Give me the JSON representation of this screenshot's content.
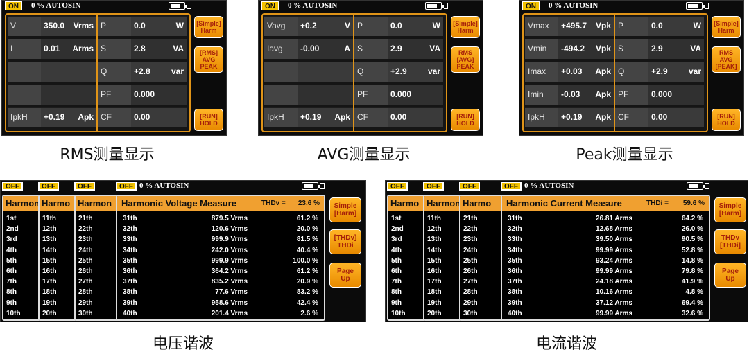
{
  "meter": {
    "status": "0 % AUTOSIN",
    "on": "ON",
    "off": "OFF"
  },
  "rms": {
    "rows_left": [
      {
        "label": "V",
        "value": "350.0",
        "unit": "Vrms"
      },
      {
        "label": "I",
        "value": "0.01",
        "unit": "Arms"
      },
      {
        "label": "",
        "value": "",
        "unit": ""
      },
      {
        "label": "",
        "value": "",
        "unit": ""
      },
      {
        "label": "IpkH",
        "value": "+0.19",
        "unit": "Apk"
      }
    ],
    "rows_right": [
      {
        "label": "P",
        "value": "0.0",
        "unit": "W"
      },
      {
        "label": "S",
        "value": "2.8",
        "unit": "VA"
      },
      {
        "label": "Q",
        "value": "+2.8",
        "unit": "var"
      },
      {
        "label": "PF",
        "value": "0.000",
        "unit": ""
      },
      {
        "label": "CF",
        "value": "0.00",
        "unit": ""
      }
    ],
    "btn1": "[Simple]\nHarm",
    "btn2": "[RMS]\nAVG\nPEAK",
    "btn3": "[RUN]\nHOLD",
    "caption": "RMS测量显示"
  },
  "avg": {
    "rows_left": [
      {
        "label": "Vavg",
        "value": "+0.2",
        "unit": "V"
      },
      {
        "label": "Iavg",
        "value": "-0.00",
        "unit": "A"
      },
      {
        "label": "",
        "value": "",
        "unit": ""
      },
      {
        "label": "",
        "value": "",
        "unit": ""
      },
      {
        "label": "IpkH",
        "value": "+0.19",
        "unit": "Apk"
      }
    ],
    "rows_right": [
      {
        "label": "P",
        "value": "0.0",
        "unit": "W"
      },
      {
        "label": "S",
        "value": "2.9",
        "unit": "VA"
      },
      {
        "label": "Q",
        "value": "+2.9",
        "unit": "var"
      },
      {
        "label": "PF",
        "value": "0.000",
        "unit": ""
      },
      {
        "label": "CF",
        "value": "0.00",
        "unit": ""
      }
    ],
    "btn1": "[Simple]\nHarm",
    "btn2": "RMS\n[AVG]\nPEAK",
    "btn3": "[RUN]\nHOLD",
    "caption": "AVG测量显示"
  },
  "peak": {
    "rows_left": [
      {
        "label": "Vmax",
        "value": "+495.7",
        "unit": "Vpk"
      },
      {
        "label": "Vmin",
        "value": "-494.2",
        "unit": "Vpk"
      },
      {
        "label": "Imax",
        "value": "+0.03",
        "unit": "Apk"
      },
      {
        "label": "Imin",
        "value": "-0.03",
        "unit": "Apk"
      },
      {
        "label": "IpkH",
        "value": "+0.19",
        "unit": "Apk"
      }
    ],
    "rows_right": [
      {
        "label": "P",
        "value": "0.0",
        "unit": "W"
      },
      {
        "label": "S",
        "value": "2.9",
        "unit": "VA"
      },
      {
        "label": "Q",
        "value": "+2.9",
        "unit": "var"
      },
      {
        "label": "PF",
        "value": "0.000",
        "unit": ""
      },
      {
        "label": "CF",
        "value": "0.00",
        "unit": ""
      }
    ],
    "btn1": "[Simple]\nHarm",
    "btn2": "RMS\nAVG\n[PEAK]",
    "btn3": "[RUN]\nHOLD",
    "caption": "Peak测量显示"
  },
  "hv": {
    "title": "Harmonic Voltage Measure",
    "thd_label": "THDv =",
    "thd_value": "23.6 %",
    "back_heads": [
      "Harmon",
      "Harmo",
      "Harmon"
    ],
    "col1": [
      "1st",
      "2nd",
      "3rd",
      "4th",
      "5th",
      "6th",
      "7th",
      "8th",
      "9th",
      "10th"
    ],
    "col2": [
      "11th",
      "12th",
      "13th",
      "14th",
      "15th",
      "16th",
      "17th",
      "18th",
      "19th",
      "20th"
    ],
    "col3": [
      "21th",
      "22th",
      "23th",
      "24th",
      "25th",
      "26th",
      "27th",
      "28th",
      "29th",
      "30th"
    ],
    "rows": [
      [
        "31th",
        "879.5 Vrms",
        "61.2 %"
      ],
      [
        "32th",
        "120.6 Vrms",
        "20.0 %"
      ],
      [
        "33th",
        "999.9 Vrms",
        "81.5 %"
      ],
      [
        "34th",
        "242.0 Vrms",
        "40.4 %"
      ],
      [
        "35th",
        "999.9 Vrms",
        "100.0 %"
      ],
      [
        "36th",
        "364.2 Vrms",
        "61.2 %"
      ],
      [
        "37th",
        "835.2 Vrms",
        "20.9 %"
      ],
      [
        "38th",
        "77.6 Vrms",
        "83.2 %"
      ],
      [
        "39th",
        "958.6 Vrms",
        "42.4 %"
      ],
      [
        "40th",
        "201.4 Vrms",
        "2.6 %"
      ]
    ],
    "btn1": "Simple\n[Harm]",
    "btn2": "[THDv]\nTHDi",
    "btn3": "Page\nUp",
    "caption": "电压谐波"
  },
  "hc": {
    "title": "Harmonic Current Measure",
    "thd_label": "THDi =",
    "thd_value": "59.6 %",
    "back_heads": [
      "Harmo",
      "Harmon",
      "Harmo"
    ],
    "col1": [
      "1st",
      "2nd",
      "3rd",
      "4th",
      "5th",
      "6th",
      "7th",
      "8th",
      "9th",
      "10th"
    ],
    "col2": [
      "11th",
      "12th",
      "13th",
      "14th",
      "15th",
      "16th",
      "17th",
      "18th",
      "19th",
      "20th"
    ],
    "col3": [
      "21th",
      "22th",
      "23th",
      "24th",
      "25th",
      "26th",
      "27th",
      "28th",
      "29th",
      "30th"
    ],
    "rows": [
      [
        "31th",
        "26.81 Arms",
        "64.2 %"
      ],
      [
        "32th",
        "12.68 Arms",
        "26.0 %"
      ],
      [
        "33th",
        "39.50 Arms",
        "90.5 %"
      ],
      [
        "34th",
        "99.99 Arms",
        "52.8 %"
      ],
      [
        "35th",
        "93.24 Arms",
        "14.8 %"
      ],
      [
        "36th",
        "99.99 Arms",
        "79.8 %"
      ],
      [
        "37th",
        "24.18 Arms",
        "41.9 %"
      ],
      [
        "38th",
        "10.16 Arms",
        "4.8 %"
      ],
      [
        "39th",
        "37.12 Arms",
        "69.4 %"
      ],
      [
        "40th",
        "99.99 Arms",
        "32.6 %"
      ]
    ],
    "btn1": "Simple\n[Harm]",
    "btn2": "THDv\n[THDi]",
    "btn3": "Page\nUp",
    "caption": "电流谐波"
  }
}
